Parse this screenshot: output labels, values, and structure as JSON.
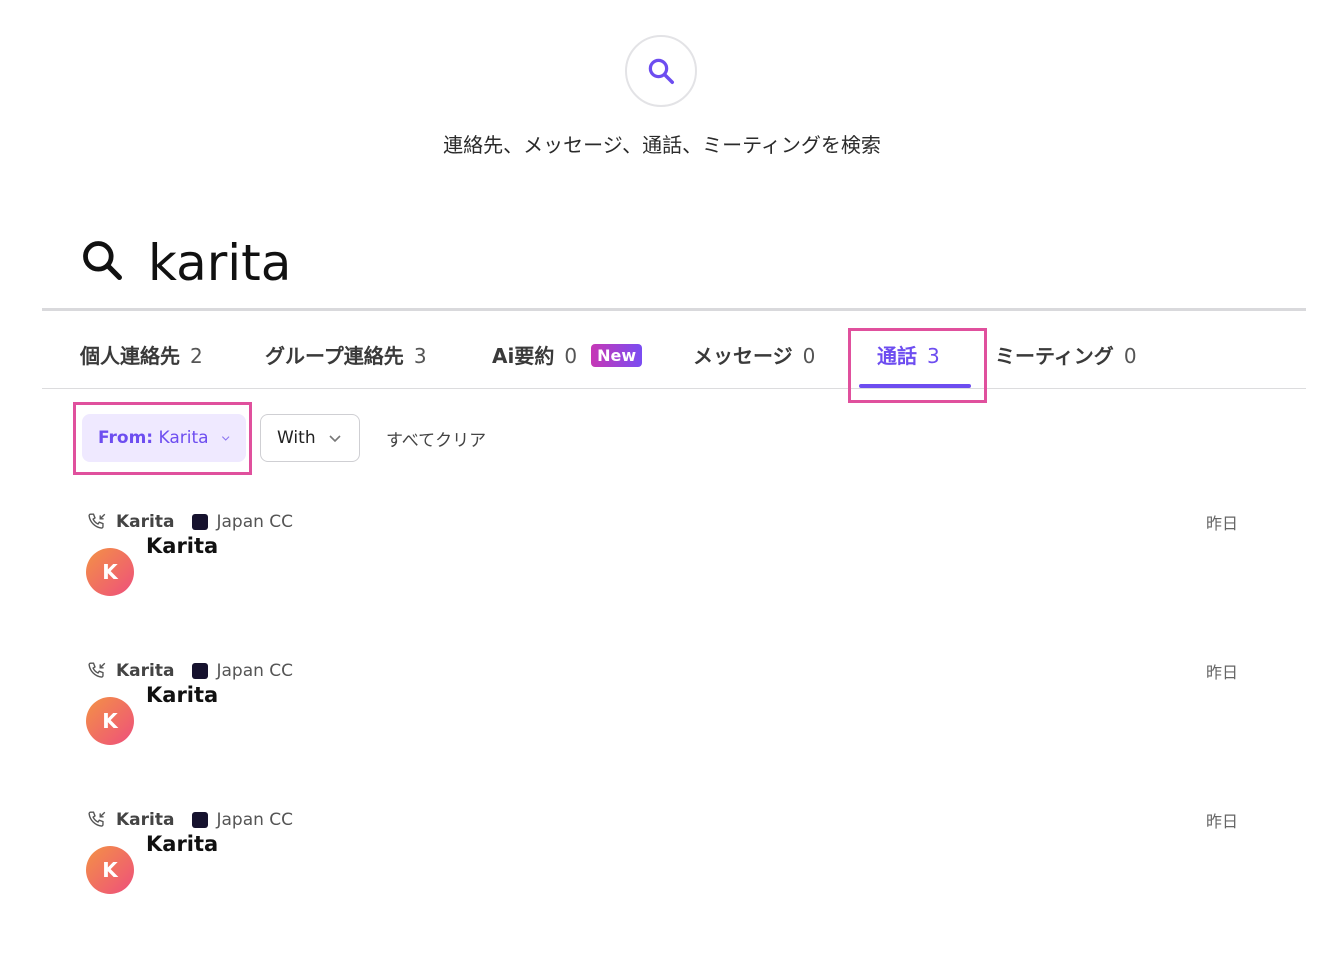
{
  "header": {
    "title": "連絡先、メッセージ、通話、ミーティングを検索"
  },
  "search": {
    "query": "karita"
  },
  "tabs": [
    {
      "label": "個人連絡先",
      "count": "2"
    },
    {
      "label": "グループ連絡先",
      "count": "3"
    },
    {
      "label": "Ai要約",
      "count": "0",
      "badge": "New"
    },
    {
      "label": "メッセージ",
      "count": "0"
    },
    {
      "label": "通話",
      "count": "3",
      "active": true
    },
    {
      "label": "ミーティング",
      "count": "0"
    }
  ],
  "filters": {
    "from_label": "From:",
    "from_value": "Karita",
    "with_label": "With",
    "clear_all": "すべてクリア"
  },
  "results": [
    {
      "caller": "Karita",
      "group": "Japan CC",
      "date": "昨日",
      "avatar_initial": "K",
      "name": "Karita"
    },
    {
      "caller": "Karita",
      "group": "Japan CC",
      "date": "昨日",
      "avatar_initial": "K",
      "name": "Karita"
    },
    {
      "caller": "Karita",
      "group": "Japan CC",
      "date": "昨日",
      "avatar_initial": "K",
      "name": "Karita"
    }
  ],
  "colors": {
    "accent": "#6d4df0",
    "highlight": "#e0509d",
    "avatar_start": "#f39245",
    "avatar_end": "#ee4f7c"
  },
  "icons": {
    "hero": "search-icon",
    "search_bar": "search-icon",
    "chip": "chevron-down-icon",
    "call": "incoming-call-icon"
  }
}
